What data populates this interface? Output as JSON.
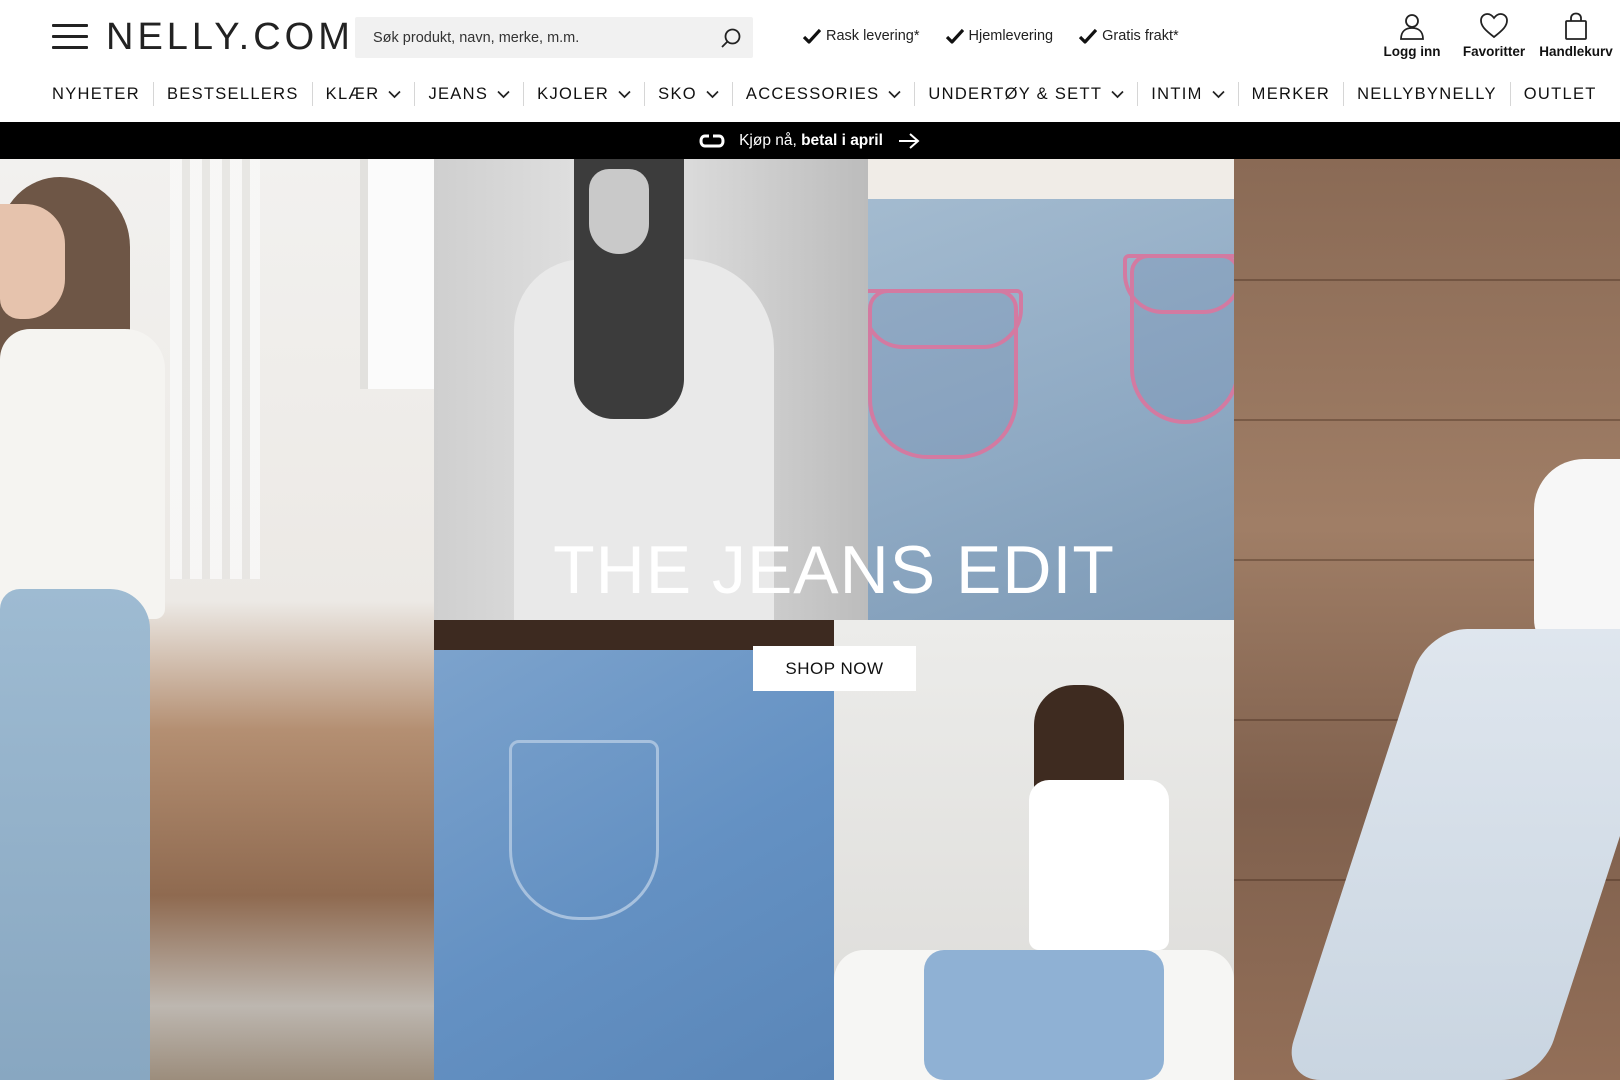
{
  "brand": {
    "logo_text": "NELLY.COM"
  },
  "search": {
    "placeholder": "Søk produkt, navn, merke, m.m."
  },
  "usps": [
    {
      "label": "Rask levering*",
      "icon": "check-icon"
    },
    {
      "label": "Hjemlevering",
      "icon": "check-icon"
    },
    {
      "label": "Gratis frakt*",
      "icon": "check-icon"
    }
  ],
  "header_actions": {
    "login": {
      "label": "Logg inn",
      "icon": "user-icon"
    },
    "favorites": {
      "label": "Favoritter",
      "icon": "heart-icon"
    },
    "cart": {
      "label": "Handlekurv",
      "icon": "shopping-bag-icon"
    }
  },
  "nav": {
    "items": [
      {
        "label": "NYHETER",
        "has_dropdown": false
      },
      {
        "label": "BESTSELLERS",
        "has_dropdown": false
      },
      {
        "label": "KLÆR",
        "has_dropdown": true
      },
      {
        "label": "JEANS",
        "has_dropdown": true
      },
      {
        "label": "KJOLER",
        "has_dropdown": true
      },
      {
        "label": "SKO",
        "has_dropdown": true
      },
      {
        "label": "ACCESSORIES",
        "has_dropdown": true
      },
      {
        "label": "UNDERTØY & SETT",
        "has_dropdown": true
      },
      {
        "label": "INTIM",
        "has_dropdown": true
      },
      {
        "label": "MERKER",
        "has_dropdown": false
      },
      {
        "label": "NELLYBYNELLY",
        "has_dropdown": false
      },
      {
        "label": "OUTLET",
        "has_dropdown": false
      }
    ]
  },
  "promo": {
    "text_prefix": "Kjøp nå, ",
    "text_bold": "betal i april",
    "icon": "klarna-link-icon",
    "arrow_icon": "arrow-right-icon"
  },
  "hero": {
    "title": "THE JEANS EDIT",
    "cta_label": "SHOP NOW"
  },
  "colors": {
    "promo_bg": "#000000",
    "search_bg": "#f1f1f1",
    "text": "#111111"
  }
}
